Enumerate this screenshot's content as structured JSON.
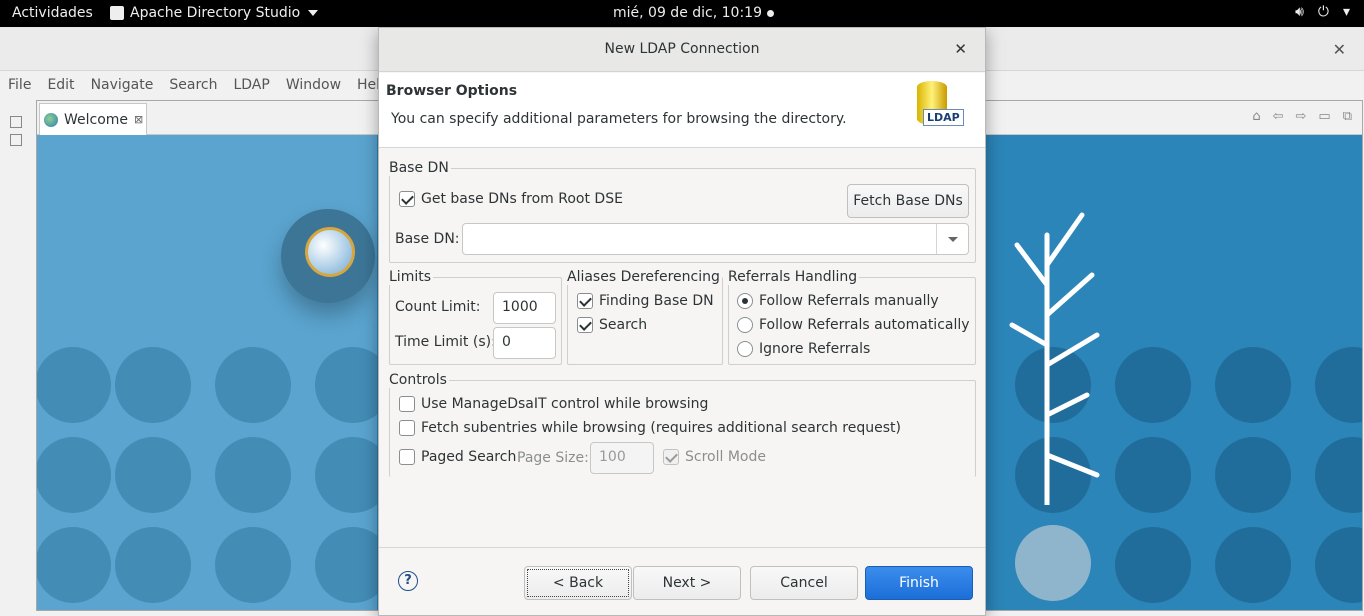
{
  "topbar": {
    "activities": "Actividades",
    "app_name": "Apache Directory Studio",
    "clock": "mié, 09 de dic, 10:19"
  },
  "menubar": [
    "File",
    "Edit",
    "Navigate",
    "Search",
    "LDAP",
    "Window",
    "Hel"
  ],
  "editor": {
    "tab_label": "Welcome"
  },
  "dialog": {
    "title": "New LDAP Connection",
    "page_title": "Browser Options",
    "page_description": "You can specify additional parameters for browsing the directory.",
    "icon_label": "LDAP",
    "base_dn_group": {
      "label": "Base DN",
      "get_from_root_dse": "Get base DNs from Root DSE",
      "get_from_root_dse_checked": true,
      "fetch_button": "Fetch Base DNs",
      "base_dn_label": "Base DN:",
      "base_dn_value": ""
    },
    "limits": {
      "label": "Limits",
      "count_limit_label": "Count Limit:",
      "count_limit_value": "1000",
      "time_limit_label": "Time Limit (s):",
      "time_limit_value": "0"
    },
    "aliases": {
      "label": "Aliases Dereferencing",
      "finding_base_dn": "Finding Base DN",
      "finding_base_dn_checked": true,
      "search": "Search",
      "search_checked": true
    },
    "referrals": {
      "label": "Referrals Handling",
      "options": [
        "Follow Referrals manually",
        "Follow Referrals automatically",
        "Ignore Referrals"
      ],
      "selected": "Follow Referrals manually"
    },
    "controls": {
      "label": "Controls",
      "manage_dsa_it": "Use ManageDsaIT control while browsing",
      "manage_dsa_it_checked": false,
      "fetch_subentries": "Fetch subentries while browsing (requires additional search request)",
      "fetch_subentries_checked": false,
      "paged_search": "Paged Search",
      "paged_search_checked": false,
      "page_size_label": "Page Size:",
      "page_size_value": "100",
      "scroll_mode": "Scroll Mode",
      "scroll_mode_checked": true
    },
    "buttons": {
      "help": "?",
      "back": "< Back",
      "next": "Next >",
      "cancel": "Cancel",
      "finish": "Finish"
    }
  },
  "colors": {
    "finish_button": "#1c6fd8",
    "welcome_background": "#2b85b8"
  }
}
